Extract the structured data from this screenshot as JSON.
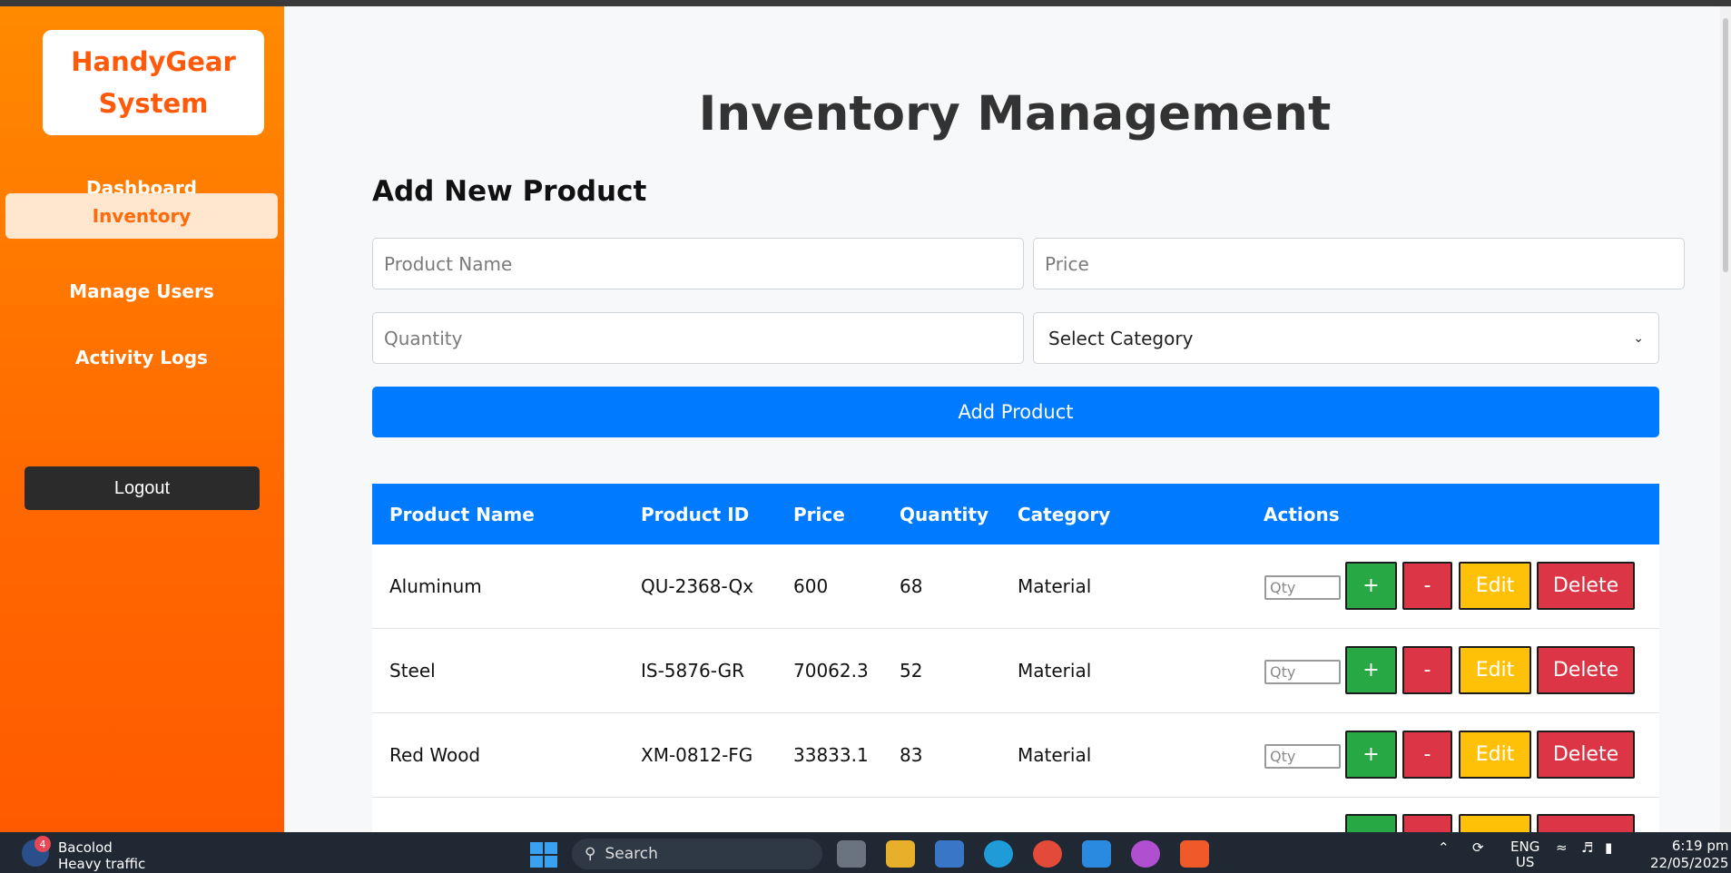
{
  "sidebar": {
    "brand_line1": "HandyGear",
    "brand_line2": "System",
    "items": [
      {
        "label": "Dashboard",
        "active": false
      },
      {
        "label": "Inventory",
        "active": true
      },
      {
        "label": "Manage Users",
        "active": false
      },
      {
        "label": "Activity Logs",
        "active": false
      }
    ],
    "logout_label": "Logout"
  },
  "main": {
    "page_title": "Inventory Management",
    "section_title": "Add New Product",
    "form": {
      "product_name_placeholder": "Product Name",
      "price_placeholder": "Price",
      "quantity_placeholder": "Quantity",
      "category_selected": "Select Category",
      "add_button_label": "Add Product"
    },
    "table": {
      "headers": [
        "Product Name",
        "Product ID",
        "Price",
        "Quantity",
        "Category",
        "Actions"
      ],
      "rows": [
        {
          "name": "Aluminum",
          "id": "QU-2368-Qx",
          "price": "600",
          "quantity": "68",
          "category": "Material"
        },
        {
          "name": "Steel",
          "id": "IS-5876-GR",
          "price": "70062.3",
          "quantity": "52",
          "category": "Material"
        },
        {
          "name": "Red Wood",
          "id": "XM-0812-FG",
          "price": "33833.1",
          "quantity": "83",
          "category": "Material"
        }
      ],
      "qty_placeholder": "Qty",
      "plus_label": "+",
      "minus_label": "-",
      "edit_label": "Edit",
      "delete_label": "Delete"
    }
  },
  "colors": {
    "sidebar_orange": "#ff6a00",
    "primary_blue": "#007bff",
    "success_green": "#28a745",
    "danger_red": "#dc3545",
    "warning_yellow": "#ffc107"
  },
  "taskbar": {
    "weather_city": "Bacolod",
    "weather_status": "Heavy traffic",
    "weather_badge": "4",
    "search_label": "Search",
    "lang_line1": "ENG",
    "lang_line2": "US",
    "time": "6:19 pm",
    "date": "22/05/2025"
  }
}
